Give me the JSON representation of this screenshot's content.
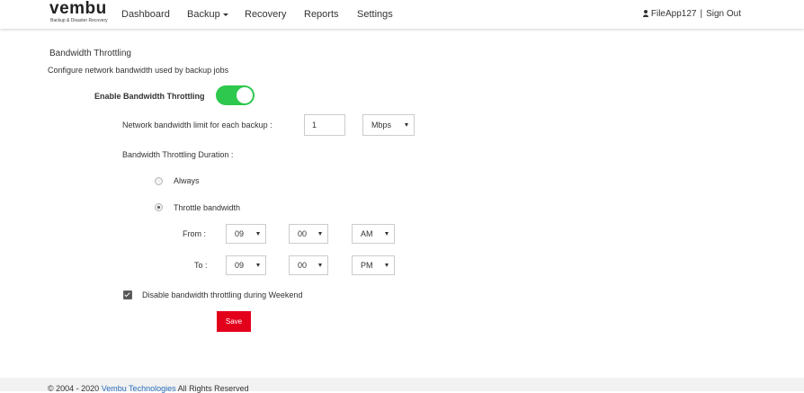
{
  "brand": {
    "name": "vembu",
    "tagline": "Backup & Disaster Recovery"
  },
  "nav": {
    "dashboard": "Dashboard",
    "backup": "Backup",
    "recovery": "Recovery",
    "reports": "Reports",
    "settings": "Settings"
  },
  "user": {
    "name": "FileApp127",
    "separator": "|",
    "sign_out": "Sign Out"
  },
  "section": {
    "title": "Bandwidth Throttling",
    "description": "Configure network bandwidth used by backup jobs"
  },
  "throttling": {
    "enable_label": "Enable Bandwidth Throttling",
    "enabled": true,
    "limit_label": "Network bandwidth limit for each backup :",
    "limit_value": "1",
    "unit": "Mbps",
    "duration_label": "Bandwidth Throttling Duration :",
    "always_label": "Always",
    "throttle_label": "Throttle bandwidth",
    "selected_mode": "Throttle bandwidth",
    "from": {
      "label": "From :",
      "hour": "09",
      "minute": "00",
      "meridiem": "AM"
    },
    "to": {
      "label": "To :",
      "hour": "09",
      "minute": "00",
      "meridiem": "PM"
    },
    "weekend_label": "Disable bandwidth throttling during Weekend",
    "weekend_checked": true
  },
  "actions": {
    "save": "Save"
  },
  "footer": {
    "prefix": "© 2004 - 2020",
    "company": "Vembu Technologies",
    "suffix": "All Rights Reserved"
  },
  "colors": {
    "toggle_on": "#2dc84d",
    "save_button": "#e3001b",
    "link": "#2a6ebb"
  }
}
